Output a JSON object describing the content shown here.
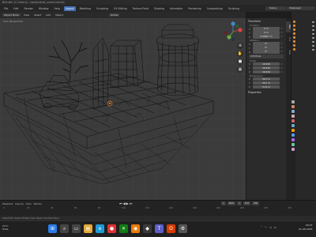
{
  "window": {
    "title": "Blender [C:\\Users\\...\\wasteland_scene.blend]"
  },
  "menu": {
    "items": [
      "File",
      "Edit",
      "Render",
      "Window",
      "Help",
      "Layout",
      "Modeling",
      "Sculpting",
      "UV Editing",
      "Texture Paint",
      "Shading",
      "Animation",
      "Rendering",
      "Compositing",
      "Scripting"
    ],
    "active": "Layout",
    "scene": "Scene",
    "view_layer": "ViewLayer"
  },
  "header": {
    "mode": "Object Mode",
    "view": "View",
    "select": "Select",
    "add": "Add",
    "object": "Object",
    "orientation": "Global"
  },
  "viewport": {
    "label": "User Perspective"
  },
  "n_panel": {
    "transform_title": "Transform",
    "location_label": "Location:",
    "location": [
      {
        "axis": "X",
        "value": "0 m"
      },
      {
        "axis": "Y",
        "value": "0 m"
      },
      {
        "axis": "Z",
        "value": "0.00007 m"
      }
    ],
    "rotation_label": "Rotation:",
    "rotation": [
      {
        "axis": "X",
        "value": "0°"
      },
      {
        "axis": "Y",
        "value": "0°"
      },
      {
        "axis": "Z",
        "value": "0°"
      }
    ],
    "rotation_mode": "XYZ Euler",
    "scale_label": "Scale:",
    "scale": [
      {
        "axis": "X",
        "value": "16.344"
      },
      {
        "axis": "Y",
        "value": "16.344"
      },
      {
        "axis": "Z",
        "value": "16.344"
      }
    ],
    "dimensions_label": "Dimensions:",
    "dimensions": [
      {
        "axis": "X",
        "value": "30.7 m"
      },
      {
        "axis": "Y",
        "value": "30.7 m"
      },
      {
        "axis": "Z",
        "value": "5.13 m"
      }
    ],
    "properties_title": "Properties",
    "tabs": [
      "Item",
      "Tool",
      "View"
    ]
  },
  "timeline": {
    "playback": "Playback",
    "keying": "Keying",
    "view": "View",
    "marker": "Marker",
    "current_frame": "1",
    "start_label": "Start",
    "start": "1",
    "end_label": "End",
    "end": "250",
    "ruler": [
      "0",
      "20",
      "40",
      "60",
      "80",
      "100",
      "120",
      "140",
      "160",
      "180",
      "200",
      "220",
      "240"
    ]
  },
  "status": {
    "text": "Select    Box Select    Rotate View    Object Context Menu"
  },
  "taskbar": {
    "temp": "22°C",
    "weather": "Haze",
    "time": "09:15",
    "date": "21-09-2023"
  },
  "colors": {
    "accent": "#4772b3",
    "wire": "#0a0a0a",
    "select_origin": "#e07a1f"
  }
}
